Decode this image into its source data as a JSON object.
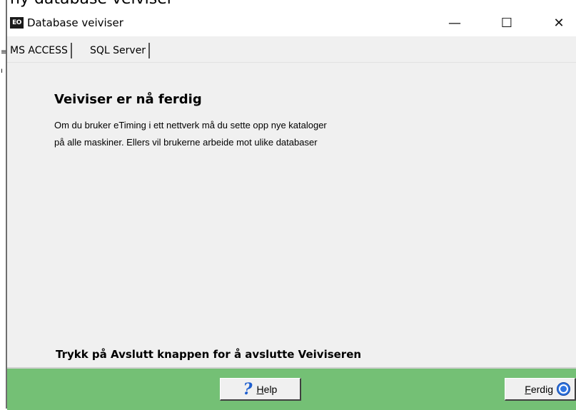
{
  "background_caption": "ny database veiviser",
  "window": {
    "icon_text": "EO",
    "title": "Database veiviser",
    "controls": {
      "minimize": "—",
      "maximize": "☐",
      "close": "✕"
    }
  },
  "tabs": [
    {
      "label": "MS ACCESS"
    },
    {
      "label": "SQL Server"
    }
  ],
  "main": {
    "heading": "Veiviser er nå ferdig",
    "description_line1": "Om du bruker eTiming i ett nettverk må du sette opp nye kataloger",
    "description_line2": "på alle maskiner. Ellers vil brukerne arbeide mot ulike databaser",
    "footer_instruction": "Trykk på Avslutt knappen for å avslutte Veiviseren"
  },
  "buttons": {
    "help": {
      "mnemonic": "H",
      "rest": "elp"
    },
    "finish": {
      "mnemonic": "F",
      "rest": "erdig"
    }
  },
  "colors": {
    "button_bar": "#74c075",
    "dialog_bg": "#f0f0f0"
  }
}
